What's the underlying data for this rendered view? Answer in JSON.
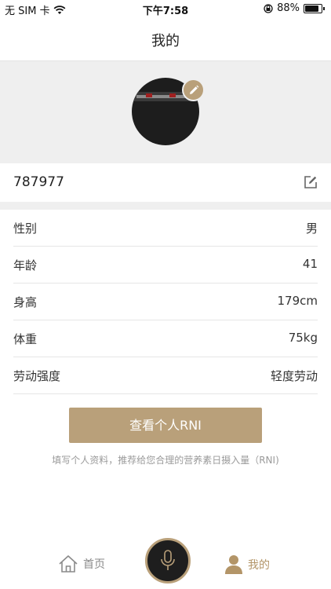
{
  "status_bar": {
    "carrier": "无 SIM 卡",
    "time": "下午7:58",
    "battery_percent": "88%",
    "battery_level": 0.88
  },
  "nav": {
    "title": "我的"
  },
  "profile": {
    "user_id": "787977"
  },
  "info": [
    {
      "label": "性别",
      "value": "男"
    },
    {
      "label": "年龄",
      "value": "41"
    },
    {
      "label": "身高",
      "value": "179cm"
    },
    {
      "label": "体重",
      "value": "75kg"
    },
    {
      "label": "劳动强度",
      "value": "轻度劳动"
    }
  ],
  "actions": {
    "rni_button": "查看个人RNI",
    "hint": "填写个人资料，推荐给您合理的营养素日摄入量（RNI)"
  },
  "tab_bar": {
    "home_label": "首页",
    "mine_label": "我的"
  },
  "colors": {
    "accent": "#b9a07a",
    "active_tab": "#b39568",
    "background_band": "#efefef"
  },
  "icons": [
    "wifi-icon",
    "location-lock-icon",
    "battery-icon",
    "pencil-icon",
    "edit-square-icon",
    "home-icon",
    "microphone-icon",
    "person-icon"
  ]
}
